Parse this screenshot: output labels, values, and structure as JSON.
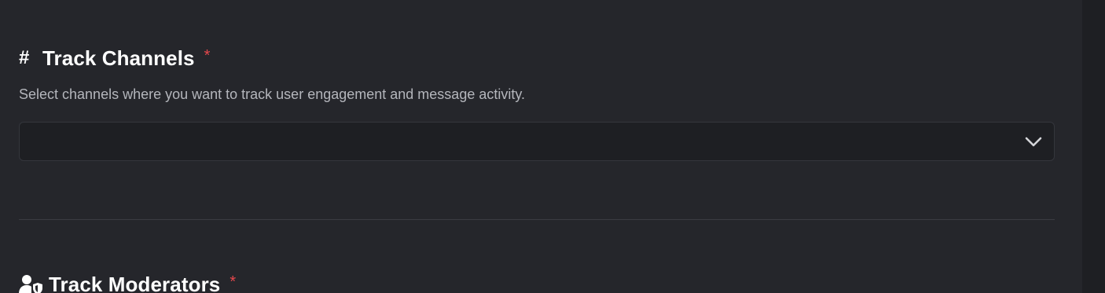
{
  "track_channels": {
    "title": "Track Channels",
    "required_mark": "*",
    "description": "Select channels where you want to track user engagement and message activity.",
    "select_value": "",
    "icon": "hash-icon"
  },
  "track_moderators": {
    "title": "Track Moderators",
    "required_mark": "*",
    "icon": "user-shield-icon"
  },
  "colors": {
    "background": "#25262b",
    "input_background": "#1e1f23",
    "required": "#e5484d",
    "description_text": "#b4b6bc"
  }
}
